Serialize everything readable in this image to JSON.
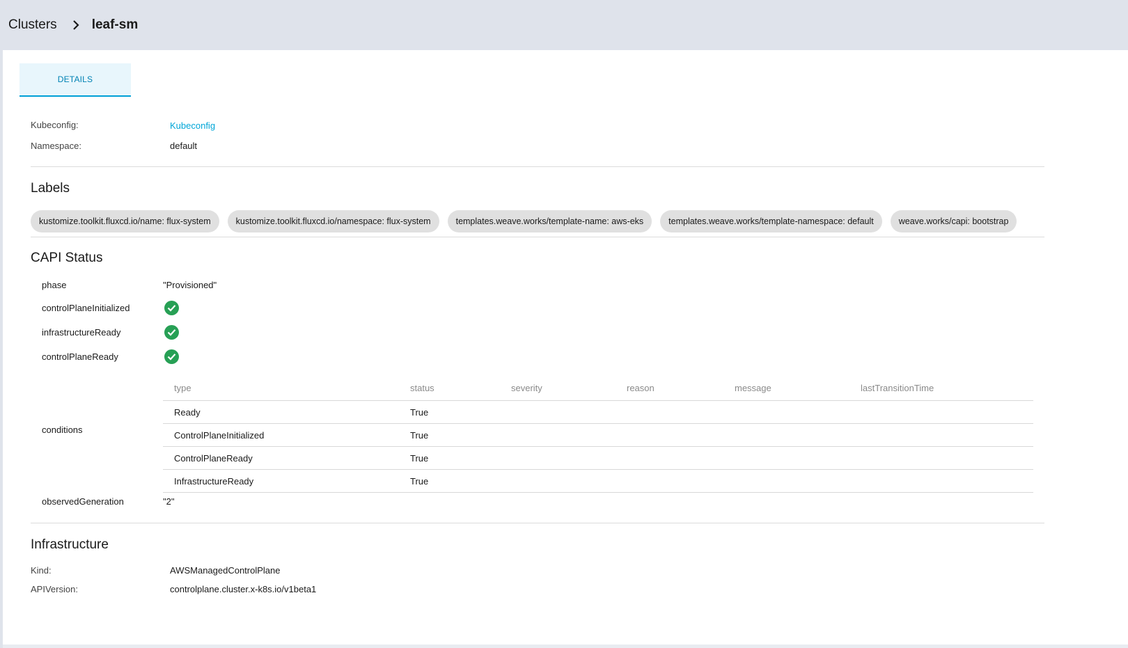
{
  "breadcrumb": {
    "root": "Clusters",
    "current": "leaf-sm"
  },
  "tabs": [
    {
      "label": "DETAILS"
    }
  ],
  "details": {
    "kubeconfig_label": "Kubeconfig:",
    "kubeconfig_link": "Kubeconfig",
    "namespace_label": "Namespace:",
    "namespace_value": "default"
  },
  "labels": {
    "title": "Labels",
    "items": [
      "kustomize.toolkit.fluxcd.io/name: flux-system",
      "kustomize.toolkit.fluxcd.io/namespace: flux-system",
      "templates.weave.works/template-name: aws-eks",
      "templates.weave.works/template-namespace: default",
      "weave.works/capi: bootstrap"
    ]
  },
  "capi_status": {
    "title": "CAPI Status",
    "phase_key": "phase",
    "phase_value": "\"Provisioned\"",
    "flags": [
      {
        "key": "controlPlaneInitialized",
        "value": true,
        "icon": "check-circle-icon"
      },
      {
        "key": "infrastructureReady",
        "value": true,
        "icon": "check-circle-icon"
      },
      {
        "key": "controlPlaneReady",
        "value": true,
        "icon": "check-circle-icon"
      }
    ],
    "conditions_key": "conditions",
    "conditions_columns": [
      "type",
      "status",
      "severity",
      "reason",
      "message",
      "lastTransitionTime"
    ],
    "conditions_rows": [
      {
        "type": "Ready",
        "status": "True",
        "severity": "",
        "reason": "",
        "message": "",
        "lastTransitionTime": ""
      },
      {
        "type": "ControlPlaneInitialized",
        "status": "True",
        "severity": "",
        "reason": "",
        "message": "",
        "lastTransitionTime": ""
      },
      {
        "type": "ControlPlaneReady",
        "status": "True",
        "severity": "",
        "reason": "",
        "message": "",
        "lastTransitionTime": ""
      },
      {
        "type": "InfrastructureReady",
        "status": "True",
        "severity": "",
        "reason": "",
        "message": "",
        "lastTransitionTime": ""
      }
    ],
    "observed_generation_key": "observedGeneration",
    "observed_generation_value": "\"2\""
  },
  "infrastructure": {
    "title": "Infrastructure",
    "kind_label": "Kind:",
    "kind_value": "AWSManagedControlPlane",
    "api_version_label": "APIVersion:",
    "api_version_value": "controlplane.cluster.x-k8s.io/v1beta1"
  },
  "colors": {
    "accent": "#00a6d8",
    "success": "#27a055",
    "chip_bg": "#e0e0e0",
    "header_bg": "#dfe3eb"
  }
}
